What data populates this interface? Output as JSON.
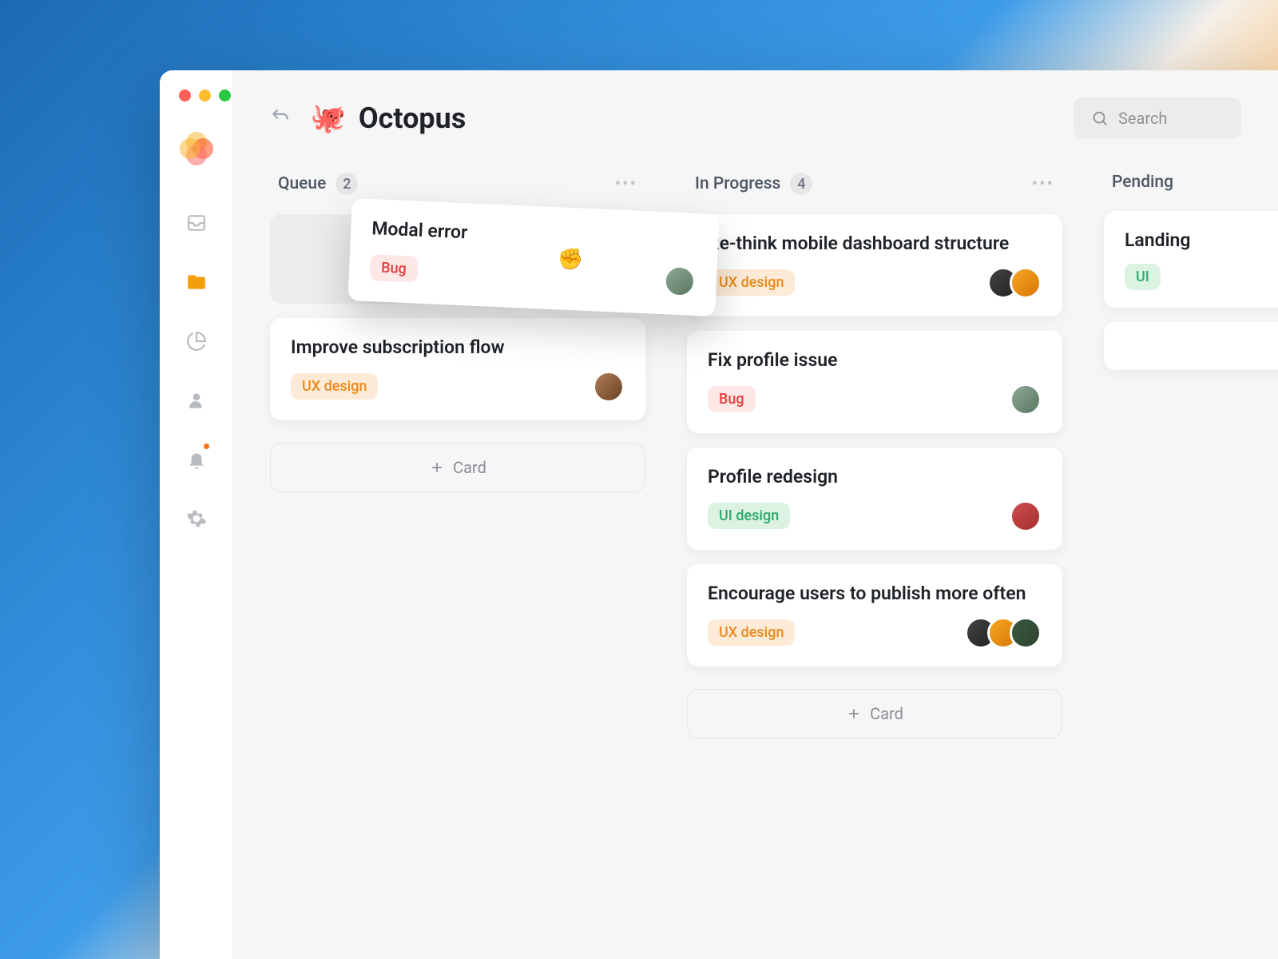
{
  "header": {
    "project_emoji": "🐙",
    "project_title": "Octopus",
    "search_placeholder": "Search"
  },
  "sidebar": {
    "items": [
      "inbox",
      "folder",
      "chart",
      "user",
      "bell",
      "settings"
    ],
    "active_index": 1,
    "bell_has_notification": true
  },
  "board": {
    "add_card_label": "Card",
    "columns": [
      {
        "title": "Queue",
        "count": "2",
        "dragging_card": {
          "title": "Modal error",
          "tag_type": "bug",
          "tag_label": "Bug"
        },
        "cards": [
          {
            "title": "Improve subscription flow",
            "tag_type": "ux",
            "tag_label": "UX design",
            "avatars": [
              "av1"
            ]
          }
        ]
      },
      {
        "title": "In Progress",
        "count": "4",
        "cards": [
          {
            "title": "Re-think mobile dashboard structure",
            "tag_type": "ux",
            "tag_label": "UX design",
            "avatars": [
              "av2",
              "av3"
            ]
          },
          {
            "title": "Fix profile issue",
            "tag_type": "bug",
            "tag_label": "Bug",
            "avatars": [
              "av4"
            ]
          },
          {
            "title": "Profile redesign",
            "tag_type": "ui",
            "tag_label": "UI design",
            "avatars": [
              "av5"
            ]
          },
          {
            "title": "Encourage users to publish more often",
            "tag_type": "ux",
            "tag_label": "UX design",
            "avatars": [
              "av2",
              "av3",
              "av6"
            ]
          }
        ]
      },
      {
        "title": "Pending",
        "count": "",
        "cards": [
          {
            "title": "Landing",
            "tag_type": "ui",
            "tag_label": "UI",
            "avatars": []
          }
        ]
      }
    ]
  }
}
